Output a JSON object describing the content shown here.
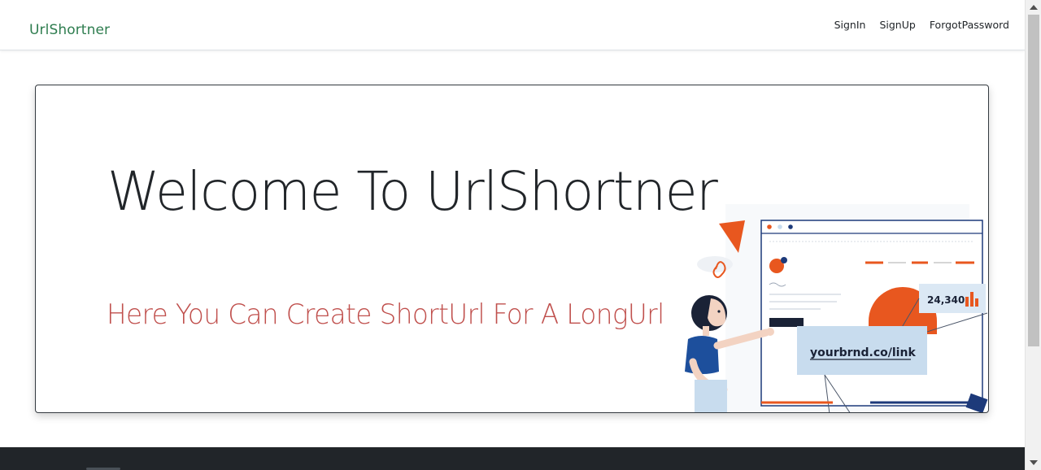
{
  "navbar": {
    "brand": "UrlShortner",
    "links": [
      "SignIn",
      "SignUp",
      "ForgotPassword"
    ]
  },
  "hero": {
    "title": "Welcome To UrlShortner",
    "subtitle": "Here You Can Create ShortUrl For A LongUrl"
  },
  "illustration": {
    "link_text": "yourbrnd.co/link",
    "stat_value": "24,340",
    "colors": {
      "orange": "#e8571f",
      "navy": "#1d3a7a",
      "light_blue": "#c8dcee"
    }
  },
  "colors": {
    "brand": "#2e7d4f",
    "subtitle": "#c0504d",
    "footer": "#212529"
  }
}
